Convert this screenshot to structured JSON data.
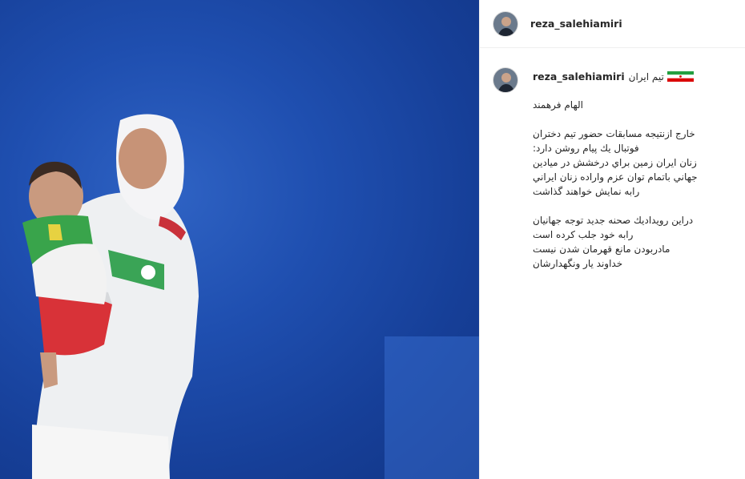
{
  "post": {
    "username": "reza_salehiamiri",
    "caption_team": "تیم ایران",
    "flag_icon": "iran-flag-icon",
    "lines": [
      "الهام فرهمند",
      "",
      "خارج ازنتیجه مسابقات حضور تیم دختران",
      "فوتبال يك پيام روشن دارد:",
      "زنان ایران زمين براي درخشش در ميادين",
      "جهاني باتمام توان عزم واراده زنان ايراني",
      "رابه نمايش خواهند گذاشت",
      "",
      "دراين رويداديك صحنه جديد توجه جهانيان",
      "رابه خود جلب كرده است",
      "مادربودن مانع قهرمان شدن نيست",
      "خداوند يار ونگهدارشان"
    ]
  },
  "colors": {
    "media_bg": "#1f4fb0",
    "text": "#262626",
    "border": "#efefef"
  }
}
